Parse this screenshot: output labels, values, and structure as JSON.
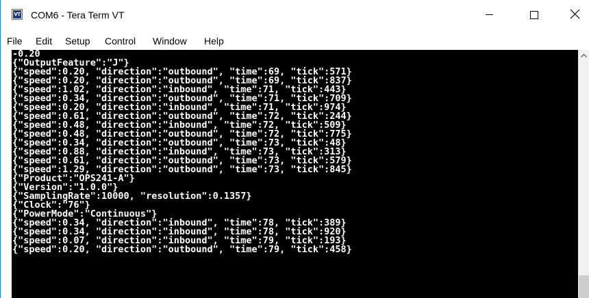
{
  "window": {
    "title": "COM6 - Tera Term VT",
    "icon": "teraterm-vt-icon",
    "icon_text": "VT"
  },
  "menu": [
    "File",
    "Edit",
    "Setup",
    "Control",
    "Window",
    "Help"
  ],
  "terminal": {
    "lines": [
      "-0.20",
      "{\"OutputFeature\":\"J\"}",
      "{\"speed\":0.20, \"direction\":\"outbound\", \"time\":69, \"tick\":571}",
      "{\"speed\":0.20, \"direction\":\"outbound\", \"time\":69, \"tick\":837}",
      "{\"speed\":1.02, \"direction\":\"inbound\", \"time\":71, \"tick\":443}",
      "{\"speed\":0.34, \"direction\":\"outbound\", \"time\":71, \"tick\":709}",
      "{\"speed\":0.20, \"direction\":\"inbound\", \"time\":71, \"tick\":974}",
      "{\"speed\":0.61, \"direction\":\"outbound\", \"time\":72, \"tick\":244}",
      "{\"speed\":0.48, \"direction\":\"inbound\", \"time\":72, \"tick\":509}",
      "{\"speed\":0.48, \"direction\":\"outbound\", \"time\":72, \"tick\":775}",
      "{\"speed\":0.34, \"direction\":\"outbound\", \"time\":73, \"tick\":48}",
      "{\"speed\":0.88, \"direction\":\"inbound\", \"time\":73, \"tick\":313}",
      "{\"speed\":0.61, \"direction\":\"outbound\", \"time\":73, \"tick\":579}",
      "{\"speed\":1.29, \"direction\":\"outbound\", \"time\":73, \"tick\":845}",
      "{\"Product\":\"OPS241-A\"}",
      "{\"Version\":\"1.0.0\"}",
      "{\"SamplingRate\":10000, \"resolution\":0.1357}",
      "{\"Clock\":\"76\"}",
      "{\"PowerMode\":\"Continuous\"}",
      "{\"speed\":0.34, \"direction\":\"inbound\", \"time\":78, \"tick\":389}",
      "{\"speed\":0.34, \"direction\":\"inbound\", \"time\":78, \"tick\":920}",
      "{\"speed\":0.07, \"direction\":\"inbound\", \"time\":79, \"tick\":193}",
      "{\"speed\":0.20, \"direction\":\"outbound\", \"time\":79, \"tick\":458}"
    ]
  },
  "colors": {
    "terminal_bg": "#000000",
    "terminal_fg": "#ffffff",
    "window_border": "#1883d7"
  },
  "icons": {
    "minimize": "minimize-icon",
    "maximize": "maximize-icon",
    "close": "close-icon",
    "scroll_up": "chevron-up-icon"
  }
}
